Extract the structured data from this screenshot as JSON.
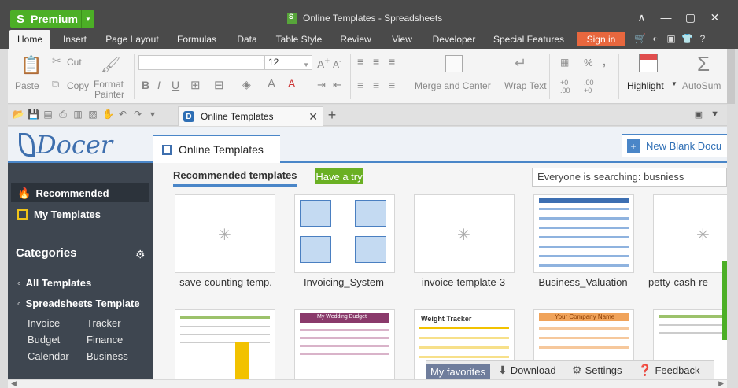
{
  "titlebar": {
    "premium_label": "Premium",
    "app_logo": "S",
    "doc_title": "Online Templates - Spreadsheets",
    "minimize_icon": "—",
    "restore_icon": "▢",
    "close_icon": "✕",
    "collapse_icon": "∧"
  },
  "menu": {
    "items": [
      {
        "label": "Home",
        "active": true
      },
      {
        "label": "Insert"
      },
      {
        "label": "Page Layout"
      },
      {
        "label": "Formulas"
      },
      {
        "label": "Data"
      },
      {
        "label": "Table Style"
      },
      {
        "label": "Review"
      },
      {
        "label": "View"
      },
      {
        "label": "Developer"
      },
      {
        "label": "Special Features"
      }
    ],
    "signin_label": "Sign in",
    "help_label": "?"
  },
  "ribbon": {
    "paste_label": "Paste",
    "cut_label": "Cut",
    "copy_label": "Copy",
    "format_painter_label_1": "Format",
    "format_painter_label_2": "Painter",
    "font_name_value": "",
    "font_size_value": "12",
    "bold": "B",
    "italic": "I",
    "underline": "U",
    "merge_center_label": "Merge and Center",
    "wrap_text_label": "Wrap Text",
    "percent_label": "%",
    "comma_label": ",",
    "decimal_inc_label": "+0 .00",
    "decimal_dec_label": ".00 +0",
    "highlight_label": "Highlight",
    "autosum_label": "AutoSum"
  },
  "tabbar": {
    "tab_label": "Online Templates",
    "tab_icon_letter": "D",
    "close_label": "✕",
    "new_tab_label": "+"
  },
  "docer": {
    "logo_text": "Docer",
    "header_tab_label": "Online Templates",
    "new_blank_label": "New Blank Docu"
  },
  "sidebar": {
    "recommended_label": "Recommended",
    "my_templates_label": "My Templates",
    "categories_label": "Categories",
    "all_templates_label": "All Templates",
    "spreadsheets_template_label": "Spreadsheets Template",
    "sub_items": [
      "Invoice",
      "Tracker",
      "Budget",
      "Finance",
      "Calendar",
      "Business"
    ]
  },
  "main": {
    "recommended_templates_label": "Recommended templates",
    "have_a_try_label": "Have a try",
    "search_placeholder": "Everyone is searching: busniess",
    "templates_row1": [
      "save-counting-temp.",
      "Invoicing_System",
      "invoice-template-3",
      "Business_Valuation",
      "petty-cash-re"
    ],
    "row2_titles": [
      "",
      "My Wedding Budget",
      "Weight Tracker",
      "Your Company Name",
      ""
    ]
  },
  "footer": {
    "my_favorites_label": "My favorites",
    "download_label": "Download",
    "settings_label": "Settings",
    "feedback_label": "Feedback"
  },
  "colors": {
    "titlebar": "#4a4a4a",
    "premium_green": "#4caf26",
    "signin_orange": "#e8673e",
    "sidebar": "#3e4650",
    "accent_blue": "#4a86c8",
    "try_green": "#6ab023"
  }
}
